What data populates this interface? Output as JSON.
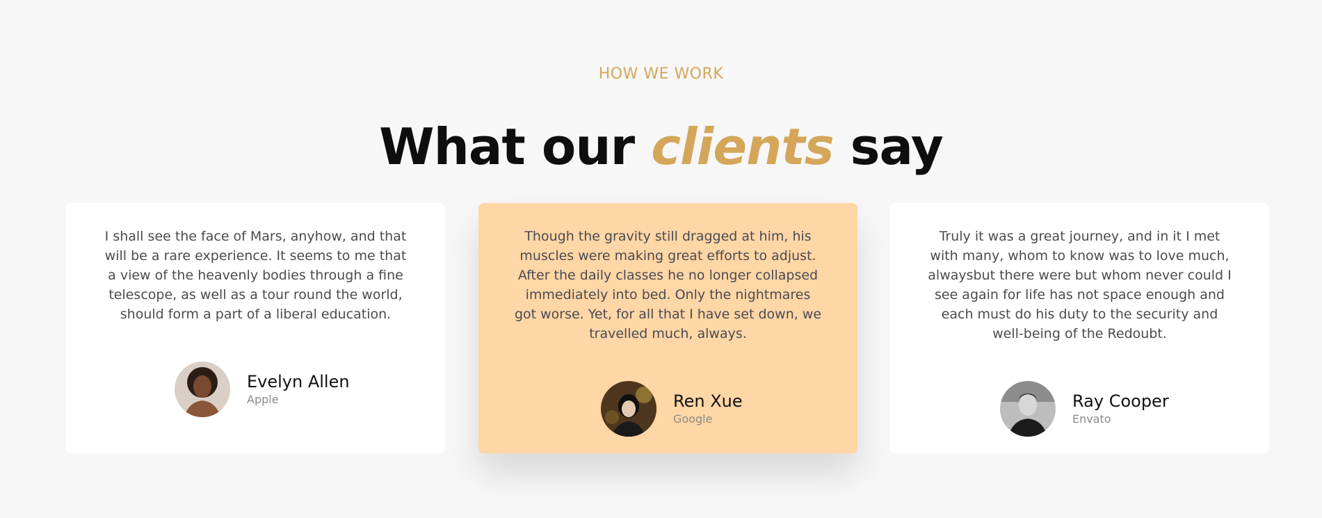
{
  "section": {
    "eyebrow": "HOW WE WORK",
    "headline": {
      "before": "What our ",
      "accent": "clients",
      "after": " say"
    }
  },
  "colors": {
    "accent": "#d4a65a",
    "background": "#f7f7f7",
    "card": "#ffffff",
    "featured_card": "#ffd6a5",
    "body_text": "#4a4a52"
  },
  "testimonials": [
    {
      "quote": "I shall see the face of Mars, anyhow, and that will be a rare experience. It seems to me that a view of the heavenly bodies through a fine telescope, as well as a tour round the world, should form a part of a liberal education.",
      "name": "Evelyn Allen",
      "company": "Apple",
      "avatar": "portrait-photo",
      "featured": false
    },
    {
      "quote": "Though the gravity still dragged at him, his muscles were making great efforts to adjust. After the daily classes he no longer collapsed immediately into bed. Only the nightmares got worse. Yet, for all that I have set down, we travelled much, always.",
      "name": "Ren Xue",
      "company": "Google",
      "avatar": "portrait-photo",
      "featured": true
    },
    {
      "quote": "Truly it was a great journey, and in it I met with many, whom to know was to love much, alwaysbut there were but whom never could I see again for life has not space enough and each must do his duty to the security and well-being of the Redoubt.",
      "name": "Ray Cooper",
      "company": "Envato",
      "avatar": "portrait-photo",
      "featured": false
    }
  ]
}
